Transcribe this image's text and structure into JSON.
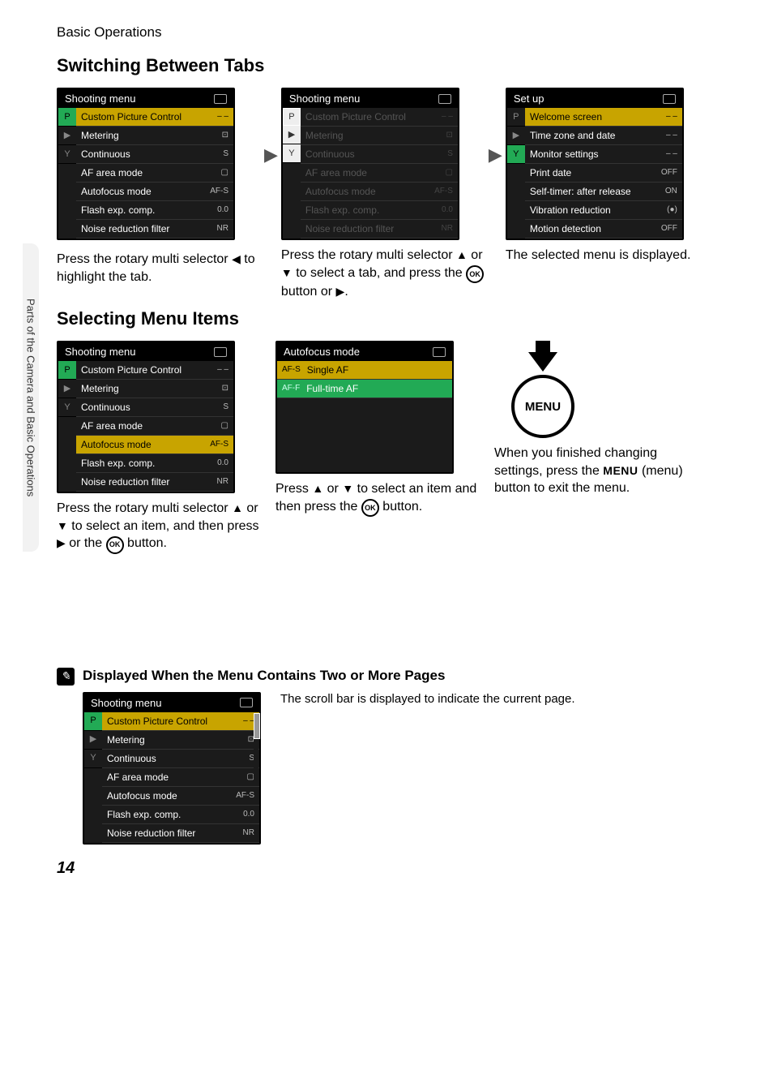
{
  "page": {
    "breadcrumb": "Basic Operations",
    "side_tab": "Parts of the Camera and Basic Operations",
    "page_number": "14"
  },
  "section1": {
    "title": "Switching Between Tabs",
    "screen1": {
      "title": "Shooting menu",
      "items": [
        {
          "label": "Custom Picture Control",
          "val": "– –",
          "hl": true
        },
        {
          "label": "Metering",
          "val": "⊡"
        },
        {
          "label": "Continuous",
          "val": "S"
        },
        {
          "label": "AF area mode",
          "val": "▢"
        },
        {
          "label": "Autofocus mode",
          "val": "AF-S"
        },
        {
          "label": "Flash exp. comp.",
          "val": "0.0"
        },
        {
          "label": "Noise reduction filter",
          "val": "NR"
        }
      ]
    },
    "screen2": {
      "title": "Shooting menu",
      "items": [
        {
          "label": "Custom Picture Control",
          "val": "– –"
        },
        {
          "label": "Metering",
          "val": "⊡"
        },
        {
          "label": "Continuous",
          "val": "S"
        },
        {
          "label": "AF area mode",
          "val": "▢"
        },
        {
          "label": "Autofocus mode",
          "val": "AF-S"
        },
        {
          "label": "Flash exp. comp.",
          "val": "0.0"
        },
        {
          "label": "Noise reduction filter",
          "val": "NR"
        }
      ]
    },
    "screen3": {
      "title": "Set up",
      "items": [
        {
          "label": "Welcome screen",
          "val": "– –",
          "hl": true
        },
        {
          "label": "Time zone and date",
          "val": "– –"
        },
        {
          "label": "Monitor settings",
          "val": "– –"
        },
        {
          "label": "Print date",
          "val": "OFF"
        },
        {
          "label": "Self-timer: after release",
          "val": "ON"
        },
        {
          "label": "Vibration reduction",
          "val": "(●)"
        },
        {
          "label": "Motion detection",
          "val": "OFF"
        }
      ]
    },
    "caption1_a": "Press the rotary multi selector ",
    "caption1_b": " to highlight the tab.",
    "caption2_a": "Press the rotary multi selector ",
    "caption2_b": " or ",
    "caption2_c": " to select a tab, and press the ",
    "caption2_d": " button or ",
    "caption2_e": ".",
    "caption3": "The selected menu is displayed."
  },
  "section2": {
    "title": "Selecting Menu Items",
    "screen1": {
      "title": "Shooting menu",
      "items": [
        {
          "label": "Custom Picture Control",
          "val": "– –"
        },
        {
          "label": "Metering",
          "val": "⊡"
        },
        {
          "label": "Continuous",
          "val": "S"
        },
        {
          "label": "AF area mode",
          "val": "▢"
        },
        {
          "label": "Autofocus mode",
          "val": "AF-S",
          "hl": true
        },
        {
          "label": "Flash exp. comp.",
          "val": "0.0"
        },
        {
          "label": "Noise reduction filter",
          "val": "NR"
        }
      ]
    },
    "screen2": {
      "title": "Autofocus mode",
      "items": [
        {
          "prefix": "AF-S",
          "label": "Single AF",
          "hl": true
        },
        {
          "prefix": "AF-F",
          "label": "Full-time AF"
        }
      ]
    },
    "menu_label": "MENU",
    "caption1_a": "Press the rotary multi selector ",
    "caption1_b": " or ",
    "caption1_c": " to select an item, and then press ",
    "caption1_d": " or the ",
    "caption1_e": " button.",
    "caption2_a": "Press ",
    "caption2_b": " or ",
    "caption2_c": " to select an item and then press the ",
    "caption2_d": " button.",
    "caption3_a": "When you finished changing settings, press the ",
    "caption3_b": " (menu) button to exit the menu."
  },
  "note": {
    "title": "Displayed When the Menu Contains Two or More Pages",
    "text": "The scroll bar is displayed to indicate the current page.",
    "screen": {
      "title": "Shooting menu",
      "items": [
        {
          "label": "Custom Picture Control",
          "val": "– –",
          "hl": true
        },
        {
          "label": "Metering",
          "val": "⊡"
        },
        {
          "label": "Continuous",
          "val": "S"
        },
        {
          "label": "AF area mode",
          "val": "▢"
        },
        {
          "label": "Autofocus mode",
          "val": "AF-S"
        },
        {
          "label": "Flash exp. comp.",
          "val": "0.0"
        },
        {
          "label": "Noise reduction filter",
          "val": "NR"
        }
      ]
    }
  },
  "glyphs": {
    "left": "◀",
    "up": "▲",
    "down": "▼",
    "right": "▶",
    "ok": "OK",
    "menu": "MENU"
  }
}
